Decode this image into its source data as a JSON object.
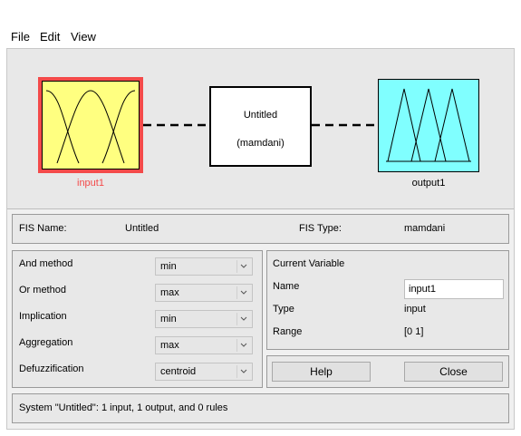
{
  "menu": {
    "file": "File",
    "edit": "Edit",
    "view": "View"
  },
  "diagram": {
    "input_label": "input1",
    "system_name": "Untitled",
    "system_type": "(mamdani)",
    "output_label": "output1",
    "colors": {
      "input_fill": "#ffff80",
      "input_border": "#f44a4a",
      "output_fill": "#80ffff",
      "input_label_color": "#f44a4a"
    }
  },
  "fis_info": {
    "name_label": "FIS Name:",
    "name_value": "Untitled",
    "type_label": "FIS Type:",
    "type_value": "mamdani"
  },
  "methods": {
    "and": {
      "label": "And method",
      "value": "min"
    },
    "or": {
      "label": "Or method",
      "value": "max"
    },
    "implication": {
      "label": "Implication",
      "value": "min"
    },
    "aggregation": {
      "label": "Aggregation",
      "value": "max"
    },
    "defuzz": {
      "label": "Defuzzification",
      "value": "centroid"
    }
  },
  "current_variable": {
    "title": "Current Variable",
    "name_label": "Name",
    "name_value": "input1",
    "type_label": "Type",
    "type_value": "input",
    "range_label": "Range",
    "range_value": "[0 1]"
  },
  "buttons": {
    "help": "Help",
    "close": "Close"
  },
  "status": "System \"Untitled\": 1 input, 1 output, and 0 rules"
}
